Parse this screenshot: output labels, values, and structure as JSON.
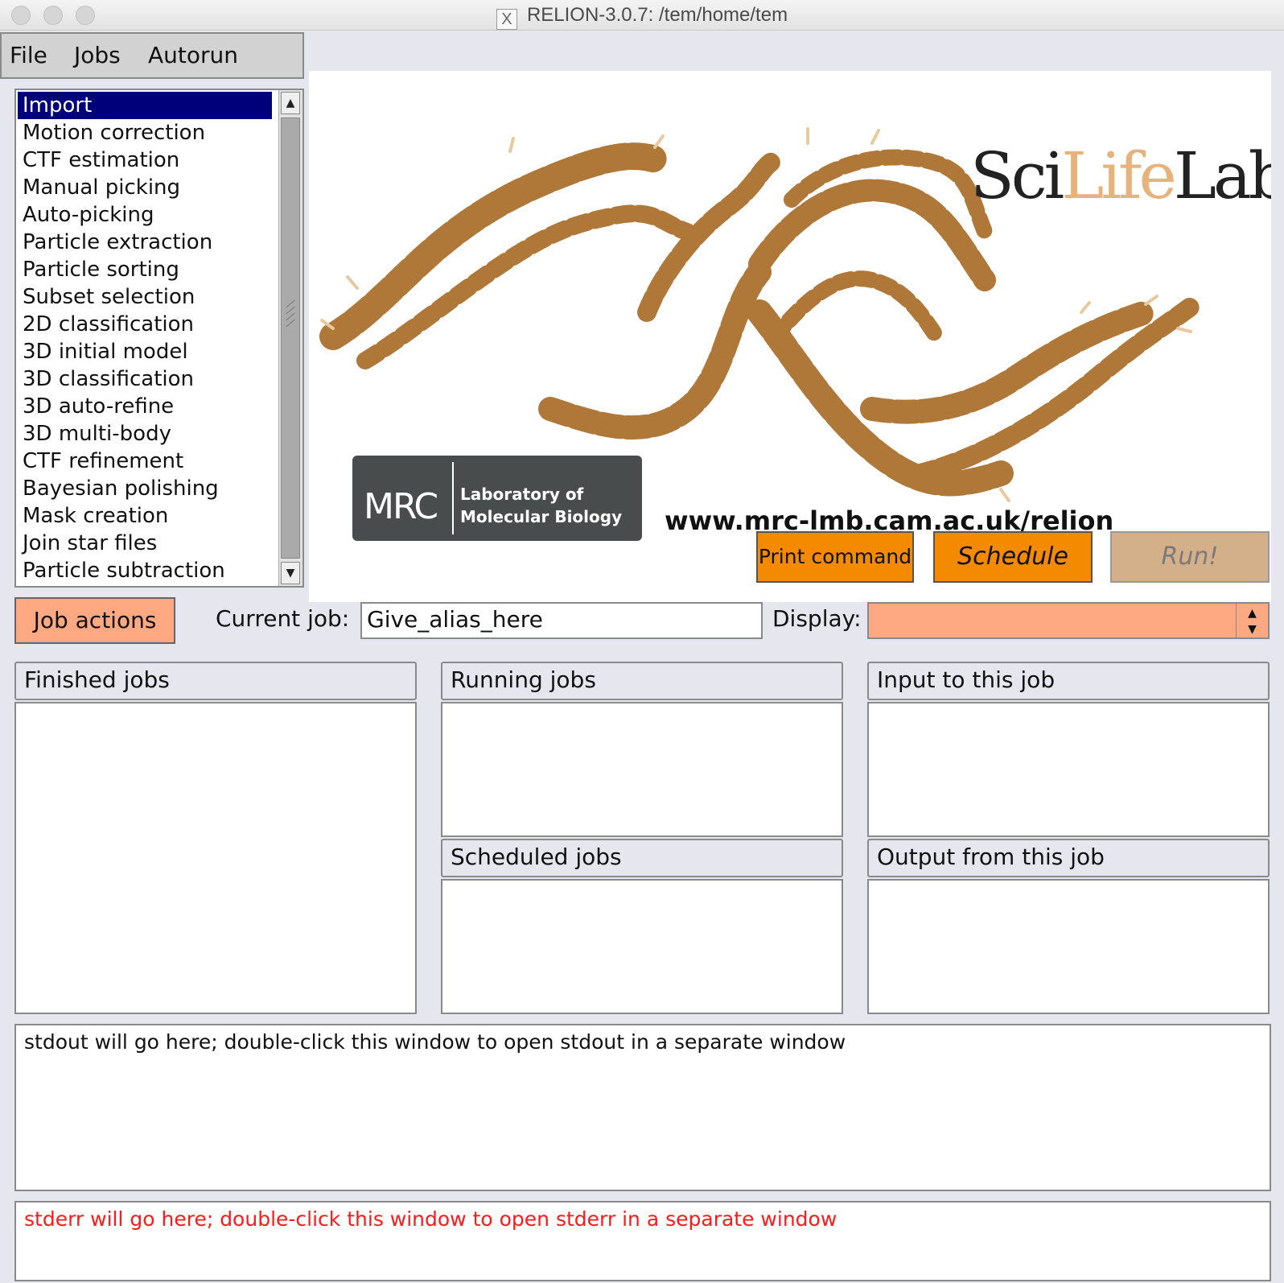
{
  "window": {
    "title": "RELION-3.0.7: /tem/home/tem"
  },
  "menubar": {
    "items": [
      "File",
      "Jobs",
      "Autorun"
    ]
  },
  "job_types": [
    "Import",
    "Motion correction",
    "CTF estimation",
    "Manual picking",
    "Auto-picking",
    "Particle extraction",
    "Particle sorting",
    "Subset selection",
    "2D classification",
    "3D initial model",
    "3D classification",
    "3D auto-refine",
    "3D multi-body",
    "CTF refinement",
    "Bayesian polishing",
    "Mask creation",
    "Join star files",
    "Particle subtraction"
  ],
  "selected_job_type": "Import",
  "banner": {
    "scilife_a": "Sci",
    "scilife_b": "Life",
    "scilife_c": "Lab",
    "mrc": "MRC",
    "mrc_line1": "Laboratory of",
    "mrc_line2": "Molecular Biology",
    "url": "www.mrc-lmb.cam.ac.uk/relion"
  },
  "buttons": {
    "print_command": "Print command",
    "schedule": "Schedule",
    "run": "Run!"
  },
  "job_actions": "Job actions",
  "current_job": {
    "label": "Current job:",
    "value": "Give_alias_here"
  },
  "display": {
    "label": "Display:",
    "value": ""
  },
  "panels": {
    "finished": "Finished jobs",
    "running": "Running jobs",
    "scheduled": "Scheduled jobs",
    "input": "Input to this job",
    "output": "Output from this job"
  },
  "stdout": "stdout will go here; double-click this window to open stdout in a separate window",
  "stderr": "stderr will go here; double-click this window to open stderr in a separate window",
  "colors": {
    "accent_orange": "#f38a00",
    "light_orange": "#ffa982",
    "selected": "#00007a",
    "banner_brown": "#b07838"
  }
}
